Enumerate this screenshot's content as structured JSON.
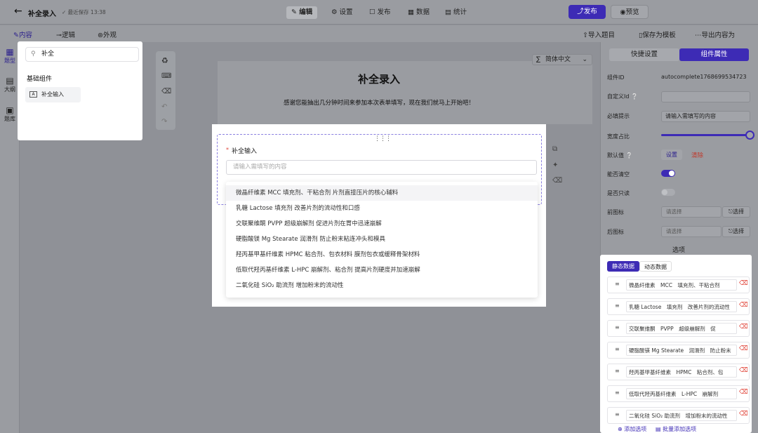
{
  "app": {
    "title": "补全录入",
    "saved": "最近保存 13:38"
  },
  "top_tabs": [
    {
      "label": "编辑"
    },
    {
      "label": "设置"
    },
    {
      "label": "发布"
    },
    {
      "label": "数据"
    },
    {
      "label": "统计"
    }
  ],
  "top_actions": {
    "publish": "发布",
    "preview": "预览"
  },
  "sub_tabs": {
    "content": "内容",
    "logic": "逻辑",
    "appearance": "外观"
  },
  "sub_actions": {
    "import": "导入题目",
    "save_template": "保存为模板",
    "export": "导出内容为"
  },
  "rail": {
    "types": "题型",
    "outline": "大纲",
    "bank": "题库"
  },
  "search": {
    "value": "补全"
  },
  "components": {
    "section": "基础组件",
    "item": "补全输入"
  },
  "language": "简体中文",
  "form": {
    "title": "补全录入",
    "description": "感谢您能抽出几分钟时间来参加本次表单填写，现在我们就马上开始吧！",
    "field_label": "补全输入",
    "required_mark": "*",
    "placeholder": "请输入需填写的内容"
  },
  "suggestions": [
    "微晶纤维素 MCC 填充剂、干粘合剂 片剂直接压片的核心辅料",
    "乳糖 Lactose 填充剂 改善片剂的流动性和口感",
    "交联聚维酮 PVPP 超级崩解剂 促进片剂在胃中迅速崩解",
    "硬脂酸镁 Mg Stearate 润滑剂 防止粉末粘连冲头和模具",
    "羟丙基甲基纤维素 HPMC 粘合剂、包衣材料 膜剂包衣或缓释骨架材料",
    "低取代羟丙基纤维素 L-HPC 崩解剂、粘合剂 提高片剂硬度并加速崩解",
    "二氧化硅 SiO₂ 助流剂 增加粉末的流动性"
  ],
  "panel": {
    "tab_quick": "快捷设置",
    "tab_props": "组件属性",
    "component_id_label": "组件ID",
    "component_id": "autocomplete1768699534723",
    "custom_id_label": "自定义Id",
    "hint_label": "必填提示",
    "hint_value": "请输入需填写的内容",
    "width_label": "宽度占比",
    "width_value": 1.0,
    "default_label": "默认值",
    "default_set": "设置",
    "default_clear": "清除",
    "clearable_label": "能否清空",
    "clearable": true,
    "readonly_label": "是否只读",
    "readonly": false,
    "prefix_label": "前图标",
    "suffix_label": "后图标",
    "select_placeholder": "请选择",
    "select_btn": "选择",
    "options_title": "选项",
    "static_tab": "静态数据",
    "dynamic_tab": "动态数据",
    "add_option": "添加选项",
    "batch_add": "批量添加选项"
  },
  "options": [
    {
      "name": "微晶纤维素",
      "code": "MCC",
      "desc": "填充剂、干粘合剂"
    },
    {
      "name": "乳糖 Lactose",
      "code": "填充剂",
      "desc": "改善片剂的流动性"
    },
    {
      "name": "交联聚维酮",
      "code": "PVPP",
      "desc": "超级崩解剂　促"
    },
    {
      "name": "硬脂酸镁 Mg Stearate",
      "code": "润滑剂",
      "desc": "防止粉末"
    },
    {
      "name": "羟丙基甲基纤维素",
      "code": "HPMC",
      "desc": "粘合剂、包"
    },
    {
      "name": "低取代羟丙基纤维素",
      "code": "L-HPC",
      "desc": "崩解剂"
    },
    {
      "name": "二氧化硅 SiO₂ 助流剂",
      "code": "",
      "desc": "增加粉末的流动性"
    }
  ],
  "colors": {
    "accent": "#3d2bb5",
    "danger": "#e0453a",
    "overlay": "#8f9197"
  }
}
